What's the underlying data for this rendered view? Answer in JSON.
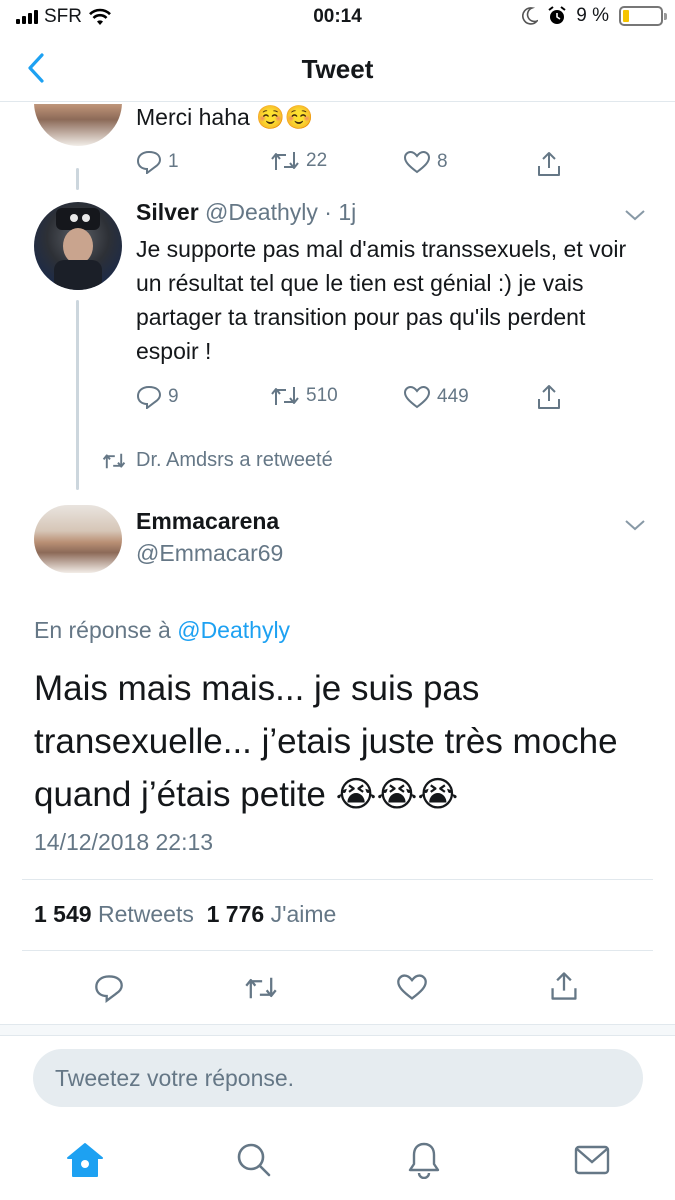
{
  "status_bar": {
    "carrier": "SFR",
    "time": "00:14",
    "battery": "9 %",
    "battery_level": 0.09
  },
  "nav": {
    "title": "Tweet"
  },
  "tweets": [
    {
      "text": "Merci haha ☺️☺️",
      "replies": "1",
      "retweets": "22",
      "likes": "8"
    },
    {
      "name": "Silver",
      "handle": "@Deathyly",
      "time": "· 1j",
      "text": "Je supporte pas mal d'amis transsexuels, et voir un résultat tel que le tien est génial :) je vais partager ta transition pour pas qu'ils perdent espoir !",
      "replies": "9",
      "retweets": "510",
      "likes": "449",
      "retweeted_by": "Dr. Amdsrs a retweeté"
    }
  ],
  "main_tweet": {
    "name": "Emmacarena",
    "handle": "@Emmacar69",
    "reply_prefix": "En réponse à",
    "reply_to": "@Deathyly",
    "text": "Mais mais mais... je suis pas transexuelle... j’etais juste très moche quand j’étais petite 😭😭😭",
    "timestamp": "14/12/2018 22:13",
    "retweets_count": "1 549",
    "retweets_label": "Retweets",
    "likes_count": "1 776",
    "likes_label": "J'aime"
  },
  "reply_box": {
    "placeholder": "Tweetez votre réponse."
  },
  "colors": {
    "accent": "#1da1f2",
    "secondary_text": "#657786",
    "divider": "#e1e8ed"
  }
}
